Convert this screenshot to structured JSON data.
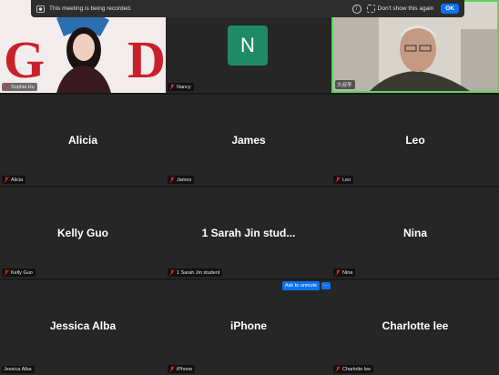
{
  "banner": {
    "text": "This meeting is being recorded.",
    "checkbox_label": "Don't show this again",
    "ok_label": "OK"
  },
  "tiles": [
    {
      "name": "Sophia Hu",
      "label": "Sophia Hu",
      "type": "video"
    },
    {
      "name": "Nancy",
      "label": "Nancy",
      "type": "avatar",
      "initial": "N",
      "avatar_color": "#1f8a66"
    },
    {
      "name": "大叔李",
      "label": "大叔李",
      "type": "video"
    },
    {
      "name": "Alicia",
      "label": "Alicia",
      "type": "name"
    },
    {
      "name": "James",
      "label": "James",
      "type": "name"
    },
    {
      "name": "Leo",
      "label": "Leo",
      "type": "name"
    },
    {
      "name": "Kelly Guo",
      "label": "Kelly Guo",
      "type": "name"
    },
    {
      "name": "1 Sarah Jin stud...",
      "label": "1 Sarah Jin student",
      "type": "name"
    },
    {
      "name": "Nina",
      "label": "Nina",
      "type": "name"
    },
    {
      "name": "Jessica Alba",
      "label": "Jessica Alba",
      "type": "name"
    },
    {
      "name": "iPhone",
      "label": "iPhone",
      "type": "name"
    },
    {
      "name": "Charlotte lee",
      "label": "Charlotte lee",
      "type": "name"
    }
  ],
  "unmute": {
    "label": "Ask to unmute",
    "more": "···"
  },
  "colors": {
    "active_speaker_border": "#5bd55b",
    "accent_blue": "#0e72ed",
    "mic_off_red": "#e02828"
  }
}
